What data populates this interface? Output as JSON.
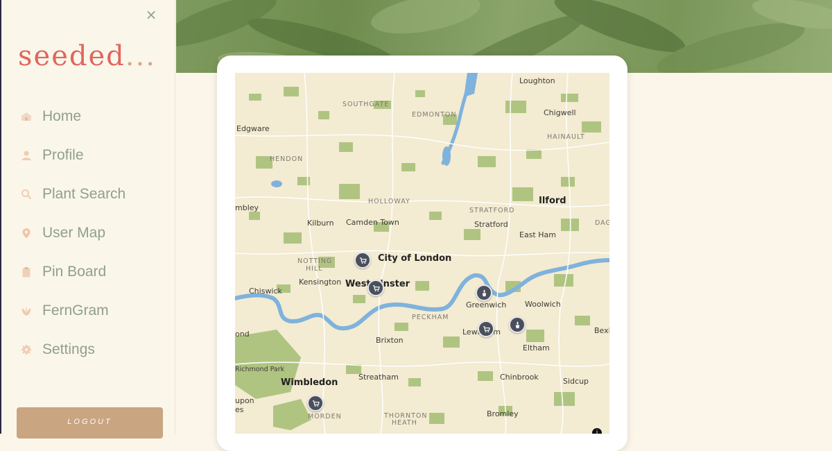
{
  "app": {
    "brand": "seeded",
    "brand_dots": "..."
  },
  "sidebar": {
    "close_icon": "×",
    "items": [
      {
        "label": "Home",
        "icon": "home-icon"
      },
      {
        "label": "Profile",
        "icon": "person-icon"
      },
      {
        "label": "Plant Search",
        "icon": "search-icon"
      },
      {
        "label": "User Map",
        "icon": "map-pin-icon"
      },
      {
        "label": "Pin Board",
        "icon": "clipboard-icon"
      },
      {
        "label": "FernGram",
        "icon": "leaf-icon"
      },
      {
        "label": "Settings",
        "icon": "gear-icon"
      }
    ],
    "logout_label": "LOGOUT"
  },
  "colors": {
    "brand": "#e0665e",
    "nav_text": "#8fa089",
    "nav_icon": "#e8c8b0",
    "logout_bg": "#c9a582",
    "pin_bg": "#4a4f5c",
    "map_water": "#7fb2dc",
    "map_green": "#a9c079"
  },
  "map": {
    "places": [
      {
        "name": "Loughton",
        "kind": "minor"
      },
      {
        "name": "SOUTHGATE",
        "kind": "district"
      },
      {
        "name": "EDMONTON",
        "kind": "district"
      },
      {
        "name": "Chigwell",
        "kind": "minor"
      },
      {
        "name": "Edgware",
        "kind": "minor"
      },
      {
        "name": "HAINAULT",
        "kind": "district"
      },
      {
        "name": "HENDON",
        "kind": "district"
      },
      {
        "name": "HOLLOWAY",
        "kind": "district"
      },
      {
        "name": "STRATFORD",
        "kind": "district"
      },
      {
        "name": "Ilford",
        "kind": "major"
      },
      {
        "name": "mbley",
        "kind": "minor"
      },
      {
        "name": "Kilburn",
        "kind": "minor"
      },
      {
        "name": "Camden Town",
        "kind": "minor"
      },
      {
        "name": "Stratford",
        "kind": "minor"
      },
      {
        "name": "East Ham",
        "kind": "minor"
      },
      {
        "name": "DAG",
        "kind": "district"
      },
      {
        "name": "NOTTING",
        "kind": "district"
      },
      {
        "name": "HILL",
        "kind": "district"
      },
      {
        "name": "City of London",
        "kind": "major"
      },
      {
        "name": "Kensington",
        "kind": "minor"
      },
      {
        "name": "Westminster",
        "kind": "major"
      },
      {
        "name": "Chiswick",
        "kind": "minor"
      },
      {
        "name": "Greenwich",
        "kind": "minor"
      },
      {
        "name": "Woolwich",
        "kind": "minor"
      },
      {
        "name": "PECKHAM",
        "kind": "district"
      },
      {
        "name": "Lewisham",
        "kind": "minor"
      },
      {
        "name": "Bexl",
        "kind": "minor"
      },
      {
        "name": "Brixton",
        "kind": "minor"
      },
      {
        "name": "Eltham",
        "kind": "minor"
      },
      {
        "name": "ond",
        "kind": "minor"
      },
      {
        "name": "Richmond Park",
        "kind": "minor"
      },
      {
        "name": "Wimbledon",
        "kind": "major"
      },
      {
        "name": "Streatham",
        "kind": "minor"
      },
      {
        "name": "Chinbrook",
        "kind": "minor"
      },
      {
        "name": "Sidcup",
        "kind": "minor"
      },
      {
        "name": "upon",
        "kind": "minor"
      },
      {
        "name": "es",
        "kind": "minor"
      },
      {
        "name": "MORDEN",
        "kind": "district"
      },
      {
        "name": "THORNTON",
        "kind": "district"
      },
      {
        "name": "HEATH",
        "kind": "district"
      },
      {
        "name": "Bromley",
        "kind": "minor"
      }
    ],
    "pins": [
      {
        "icon": "cart-icon"
      },
      {
        "icon": "cart-icon"
      },
      {
        "icon": "plant-pot-icon"
      },
      {
        "icon": "cart-icon"
      },
      {
        "icon": "plant-pot-icon"
      },
      {
        "icon": "cart-icon"
      }
    ],
    "info_glyph": "i"
  }
}
